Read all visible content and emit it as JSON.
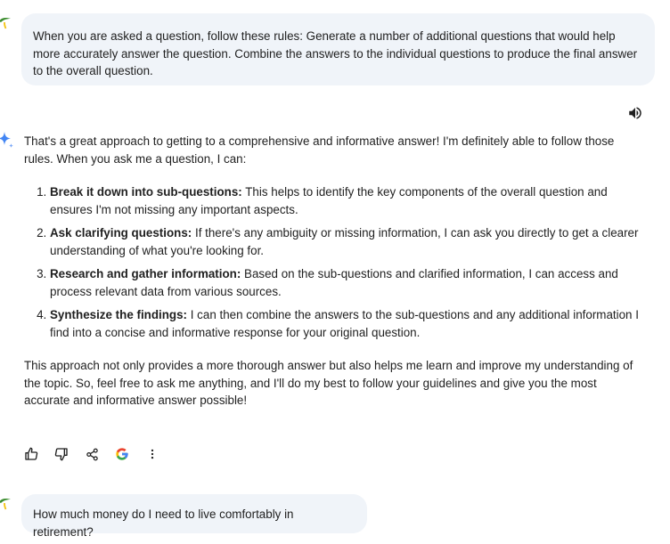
{
  "conversation": {
    "user_prompt_1": "When you are asked a question, follow these rules: Generate a number of additional questions that would help more accurately answer the question. Combine the answers to the individual questions to produce the final answer to the overall question.",
    "response": {
      "intro": "That's a great approach to getting to a comprehensive and informative answer! I'm definitely able to follow those rules. When you ask me a question, I can:",
      "steps": [
        {
          "title": "Break it down into sub-questions:",
          "text": " This helps to identify the key components of the overall question and ensures I'm not missing any important aspects."
        },
        {
          "title": "Ask clarifying questions:",
          "text": " If there's any ambiguity or missing information, I can ask you directly to get a clearer understanding of what you're looking for."
        },
        {
          "title": "Research and gather information:",
          "text": " Based on the sub-questions and clarified information, I can access and process relevant data from various sources."
        },
        {
          "title": "Synthesize the findings:",
          "text": " I can then combine the answers to the sub-questions and any additional information I find into a concise and informative response for your original question."
        }
      ],
      "outro": "This approach not only provides a more thorough answer but also helps me learn and improve my understanding of the topic. So, feel free to ask me anything, and I'll do my best to follow your guidelines and give you the most accurate and informative answer possible!"
    },
    "user_prompt_2": "How much money do I need to live comfortably in retirement?"
  },
  "icons": {
    "user_avatar": "palm-tree-icon",
    "assistant_avatar": "sparkle-icon",
    "speaker": "speaker-icon",
    "actions": [
      "thumbs-up-icon",
      "thumbs-down-icon",
      "share-icon",
      "google-icon",
      "more-vert-icon"
    ]
  },
  "colors": {
    "bubble_bg": "#f0f4f9",
    "text": "#1f1f1f",
    "sparkle_blue": "#4285f4",
    "avatar_green": "#3c8d2f",
    "avatar_yellow": "#f4c20d"
  }
}
